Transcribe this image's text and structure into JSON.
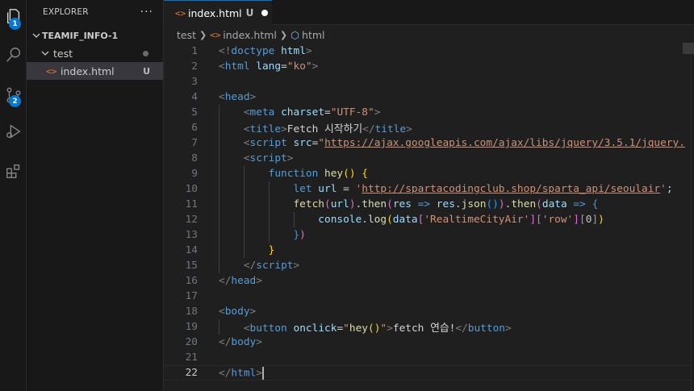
{
  "activity_bar": {
    "items": [
      {
        "icon": "files-icon",
        "badge": "1"
      },
      {
        "icon": "search-icon",
        "badge": ""
      },
      {
        "icon": "source-control-icon",
        "badge": "2"
      },
      {
        "icon": "run-debug-icon",
        "badge": ""
      },
      {
        "icon": "extensions-icon",
        "badge": ""
      }
    ]
  },
  "sidebar": {
    "title": "EXPLORER",
    "more_label": "···",
    "root_folder": "TEAMIF_INFO-1",
    "folder": "test",
    "file": {
      "name": "index.html",
      "status": "U"
    }
  },
  "tab": {
    "name": "index.html",
    "status": "U"
  },
  "breadcrumb": [
    "test",
    "index.html",
    "html"
  ],
  "editor": {
    "active_line": 22
  },
  "colors": {
    "accent": "#0078d4",
    "background": "#1f1f1f",
    "tag": "#569cd6",
    "attr": "#9cdcfe",
    "string": "#ce9178"
  }
}
